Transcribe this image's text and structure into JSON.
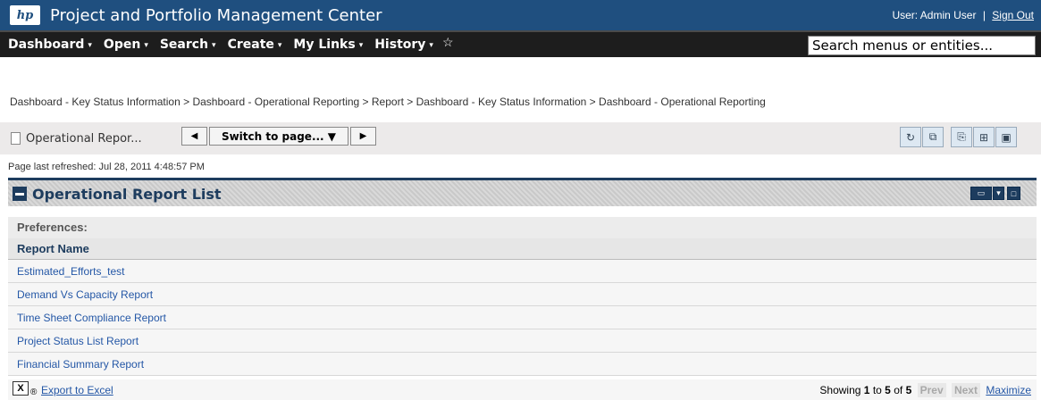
{
  "header": {
    "logo_text": "hp",
    "title": "Project and Portfolio Management Center",
    "user_label": "User: Admin User",
    "separator": "|",
    "signout_label": "Sign Out"
  },
  "menu": {
    "items": [
      {
        "label": "Dashboard"
      },
      {
        "label": "Open"
      },
      {
        "label": "Search"
      },
      {
        "label": "Create"
      },
      {
        "label": "My Links"
      },
      {
        "label": "History"
      }
    ],
    "caret": "▾",
    "star": "☆",
    "search_value": "Search menus or entities..."
  },
  "breadcrumb": "Dashboard - Key Status Information > Dashboard - Operational Reporting > Report > Dashboard - Key Status Information > Dashboard - Operational Reporting",
  "page_bar": {
    "page_name": "Operational Repor...",
    "prev_glyph": "◀",
    "next_glyph": "▶",
    "switch_label": "Switch to page... ▼",
    "tools": [
      {
        "icon": "refresh-icon",
        "glyph": "↻"
      },
      {
        "icon": "copy-page-icon",
        "glyph": "⧉"
      },
      {
        "icon": "pdf-icon",
        "glyph": "⎘"
      },
      {
        "icon": "add-portlet-icon",
        "glyph": "⊞"
      },
      {
        "icon": "personalize-icon",
        "glyph": "▣"
      }
    ]
  },
  "refreshed": "Page last refreshed: Jul 28, 2011 4:48:57 PM",
  "portlet": {
    "title": "Operational Report List",
    "preferences_label": "Preferences:",
    "column_header": "Report Name",
    "rows": [
      "Estimated_Efforts_test",
      "Demand Vs Capacity Report",
      "Time Sheet Compliance Report",
      "Project Status List Report",
      "Financial Summary Report"
    ],
    "export_label": "Export to Excel",
    "pager": {
      "showing": "Showing",
      "from": "1",
      "to_word": "to",
      "to": "5",
      "of_word": "of",
      "total": "5",
      "prev": "Prev",
      "next": "Next",
      "maximize": "Maximize"
    }
  },
  "colors": {
    "header_bg": "#1f4f7f",
    "menu_bg": "#1d1d1d",
    "portlet_accent": "#1d3c5e",
    "link": "#2457a6"
  }
}
